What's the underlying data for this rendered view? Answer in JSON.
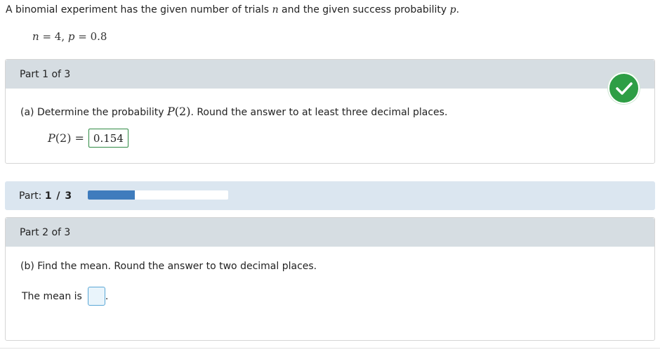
{
  "problem": {
    "statement_before": "A binomial experiment has the given number of trials ",
    "n_symbol": "n",
    "statement_middle": " and the given success probability ",
    "p_symbol": "p",
    "statement_after": ".",
    "given_n_var": "n",
    "given_eq1": " = 4, ",
    "given_p_var": "p",
    "given_eq2": " = 0.8"
  },
  "part1": {
    "header": "Part 1 of 3",
    "question_before": "(a) Determine the probability ",
    "question_func": "P",
    "question_arg": "(2)",
    "question_after": ". Round the answer to at least three decimal places.",
    "answer_func": "P",
    "answer_arg": " (2) =",
    "answer_value": "0.154",
    "status_icon": "check-icon",
    "status_color": "#2e9e45"
  },
  "progress": {
    "label_prefix": "Part: ",
    "label_value": "1 / 3",
    "fraction_complete": 0.333,
    "fill_color": "#3f7cbd"
  },
  "part2": {
    "header": "Part 2 of 3",
    "question": "(b) Find the mean. Round the answer to two decimal places.",
    "answer_prefix": "The mean is",
    "answer_value": "",
    "answer_suffix": "."
  }
}
